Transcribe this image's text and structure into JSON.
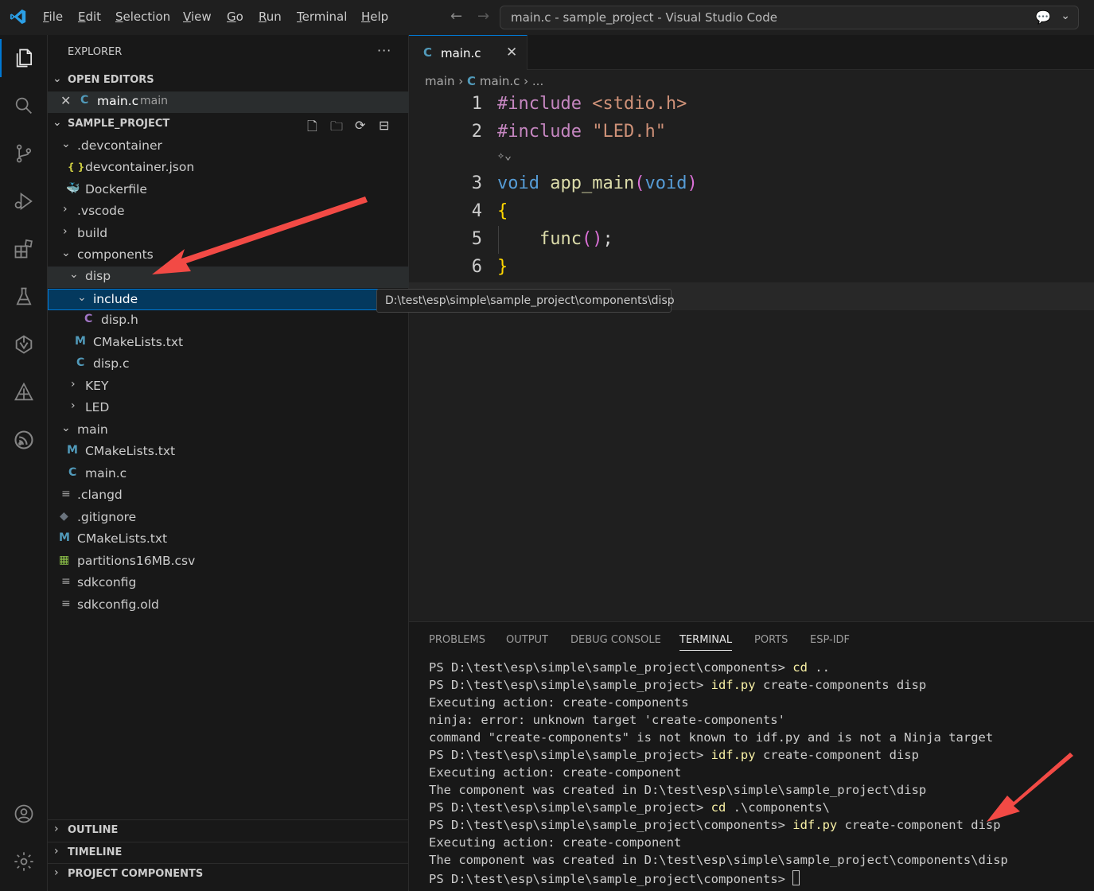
{
  "titlebar": {
    "menu": [
      {
        "key": "F",
        "rest": "ile"
      },
      {
        "key": "E",
        "rest": "dit"
      },
      {
        "key": "S",
        "rest": "election"
      },
      {
        "key": "V",
        "rest": "iew"
      },
      {
        "key": "G",
        "rest": "o"
      },
      {
        "key": "R",
        "rest": "un"
      },
      {
        "key": "T",
        "rest": "erminal"
      },
      {
        "key": "H",
        "rest": "elp"
      }
    ],
    "command_center": "main.c - sample_project - Visual Studio Code"
  },
  "activity_bar": {
    "items": [
      "explorer-icon",
      "search-icon",
      "source-control-icon",
      "run-debug-icon",
      "extensions-icon",
      "testing-icon",
      "codeium-icon",
      "platformio-icon",
      "esp-idf-icon"
    ],
    "bottom": [
      "account-icon",
      "settings-gear-icon"
    ]
  },
  "sidebar": {
    "title": "EXPLORER",
    "more": "···",
    "open_editors": {
      "header": "OPEN EDITORS",
      "items": [
        {
          "name": "main.c",
          "desc": "main"
        }
      ]
    },
    "project": {
      "header": "SAMPLE_PROJECT",
      "tree": [
        {
          "label": ".devcontainer",
          "type": "folder-open"
        },
        {
          "label": "devcontainer.json",
          "type": "json"
        },
        {
          "label": "Dockerfile",
          "type": "docker"
        },
        {
          "label": ".vscode",
          "type": "folder"
        },
        {
          "label": "build",
          "type": "folder"
        },
        {
          "label": "components",
          "type": "folder-open"
        },
        {
          "label": "disp",
          "type": "folder-open"
        },
        {
          "label": "include",
          "type": "folder-open"
        },
        {
          "label": "disp.h",
          "type": "c"
        },
        {
          "label": "CMakeLists.txt",
          "type": "cmake"
        },
        {
          "label": "disp.c",
          "type": "c"
        },
        {
          "label": "KEY",
          "type": "folder"
        },
        {
          "label": "LED",
          "type": "folder"
        },
        {
          "label": "main",
          "type": "folder-open"
        },
        {
          "label": "CMakeLists.txt",
          "type": "cmake"
        },
        {
          "label": "main.c",
          "type": "c"
        },
        {
          "label": ".clangd",
          "type": "text"
        },
        {
          "label": ".gitignore",
          "type": "git"
        },
        {
          "label": "CMakeLists.txt",
          "type": "cmake"
        },
        {
          "label": "partitions16MB.csv",
          "type": "csv"
        },
        {
          "label": "sdkconfig",
          "type": "text"
        },
        {
          "label": "sdkconfig.old",
          "type": "text"
        }
      ]
    },
    "bottom_sections": [
      "OUTLINE",
      "TIMELINE",
      "PROJECT COMPONENTS"
    ]
  },
  "editor": {
    "tab": {
      "name": "main.c",
      "icon": "C"
    },
    "breadcrumb": {
      "folder": "main",
      "file": "main.c",
      "rest": "..."
    },
    "line_numbers": [
      "1",
      "2",
      "3",
      "4",
      "5",
      "6"
    ],
    "code": {
      "l1_kw": "#include",
      "l1_arg": "<stdio.h>",
      "l2_kw": "#include",
      "l2_arg": "\"LED.h\"",
      "l3_type": "void",
      "l3_fn": "app_main",
      "l3_open": "(",
      "l3_param": "void",
      "l3_close": ")",
      "l4": "{",
      "l5_fn": "func",
      "l5_parens": "()",
      "l5_semi": ";",
      "l6": "}"
    },
    "tooltip": "D:\\test\\esp\\simple\\sample_project\\components\\disp"
  },
  "panel": {
    "tabs": [
      "PROBLEMS",
      "OUTPUT",
      "DEBUG CONSOLE",
      "TERMINAL",
      "PORTS",
      "ESP-IDF"
    ],
    "active_tab": "TERMINAL",
    "lines": [
      {
        "prompt": "PS D:\\test\\esp\\simple\\sample_project\\components> ",
        "cmd": "cd",
        "args": " .."
      },
      {
        "prompt": "PS D:\\test\\esp\\simple\\sample_project> ",
        "cmd": "idf.py",
        "args": " create-components disp"
      },
      {
        "prompt": "Executing action: create-components",
        "cmd": "",
        "args": ""
      },
      {
        "prompt": "ninja: error: unknown target 'create-components'",
        "cmd": "",
        "args": ""
      },
      {
        "prompt": "command \"create-components\" is not known to idf.py and is not a Ninja target",
        "cmd": "",
        "args": ""
      },
      {
        "prompt": "PS D:\\test\\esp\\simple\\sample_project> ",
        "cmd": "idf.py",
        "args": " create-component disp"
      },
      {
        "prompt": "Executing action: create-component",
        "cmd": "",
        "args": ""
      },
      {
        "prompt": "The component was created in D:\\test\\esp\\simple\\sample_project\\disp",
        "cmd": "",
        "args": ""
      },
      {
        "prompt": "PS D:\\test\\esp\\simple\\sample_project> ",
        "cmd": "cd",
        "args": " .\\components\\"
      },
      {
        "prompt": "PS D:\\test\\esp\\simple\\sample_project\\components> ",
        "cmd": "idf.py",
        "args": " create-component disp"
      },
      {
        "prompt": "Executing action: create-component",
        "cmd": "",
        "args": ""
      },
      {
        "prompt": "The component was created in D:\\test\\esp\\simple\\sample_project\\components\\disp",
        "cmd": "",
        "args": ""
      },
      {
        "prompt": "PS D:\\test\\esp\\simple\\sample_project\\components> ",
        "cmd": "",
        "args": ""
      }
    ]
  },
  "colors": {
    "accent": "#0078d4",
    "annotation_arrow": "#f24a45"
  }
}
